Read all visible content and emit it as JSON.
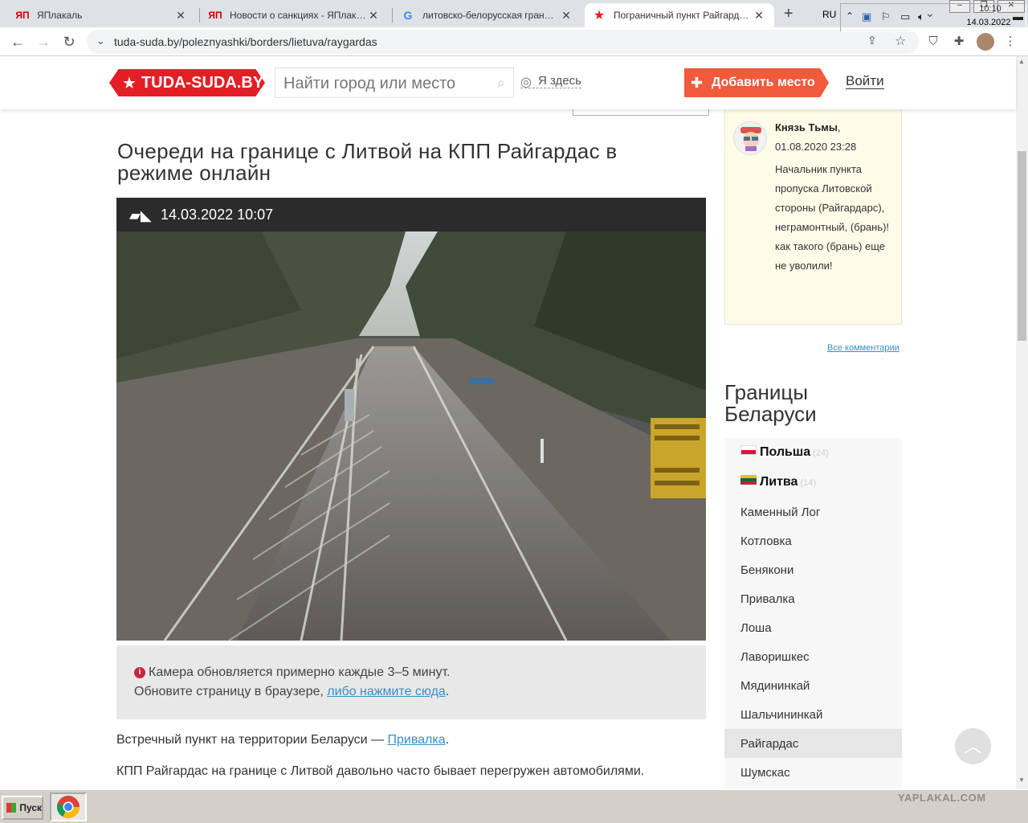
{
  "browser": {
    "tabs": [
      {
        "title": "ЯПлакаль",
        "favicon": "yaplakal-icon"
      },
      {
        "title": "Новости о санкциях - ЯПлакаль",
        "favicon": "yaplakal-icon"
      },
      {
        "title": "литовско-белорусская граница оч",
        "favicon": "google-icon"
      },
      {
        "title": "Пограничный пункт Райгардас на",
        "favicon": "star-icon"
      }
    ],
    "url": "tuda-suda.by/poleznyashki/borders/lietuva/raygardas"
  },
  "site": {
    "logo": "TUDA-SUDA.BY",
    "search_placeholder": "Найти город или место",
    "here": "Я здесь",
    "add_place": "Добавить место",
    "login": "Войти"
  },
  "main": {
    "title": "Очереди на границе с Литвой на КПП Райгардас в режиме онлайн",
    "camera_timestamp": "14.03.2022 10:07",
    "info_line1": "Камера обновляется примерно каждые 3–5 минут.",
    "info_line2": "Обновите страницу в браузере,",
    "info_link": "либо нажмите сюда",
    "para1_prefix": "Встречный пункт на территории Беларуси —",
    "para1_link": "Привалка",
    "para2": "КПП Райгардас на границе с Литвой давольно часто бывает перегружен автомобилями."
  },
  "comment": {
    "author": "Князь Тьмы",
    "date": "01.08.2020 23:28",
    "text": "Начальник пункта пропуска Литовской стороны (Райгардарс), неграмонтный, (брань)! как такого (брань) еще не уволили!",
    "all_comments": "Все комментарии"
  },
  "borders": {
    "title": "Границы Беларуси",
    "countries": [
      {
        "name": "Польша",
        "count": "(24)"
      },
      {
        "name": "Литва",
        "count": "(14)"
      }
    ],
    "points": [
      "Каменный Лог",
      "Котловка",
      "Бенякони",
      "Привалка",
      "Лоша",
      "Лаворишкес",
      "Мядининкай",
      "Шальчининкай",
      "Райгардас",
      "Шумскас"
    ],
    "active": "Райгардас"
  },
  "taskbar": {
    "start": "Пуск",
    "lang": "RU",
    "time": "10:10",
    "date": "14.03.2022",
    "watermark": "YAPLAKAL.COM"
  },
  "colors": {
    "brand_red": "#e31e24",
    "add_button": "#f15a3a",
    "link": "#3a8dc9"
  }
}
